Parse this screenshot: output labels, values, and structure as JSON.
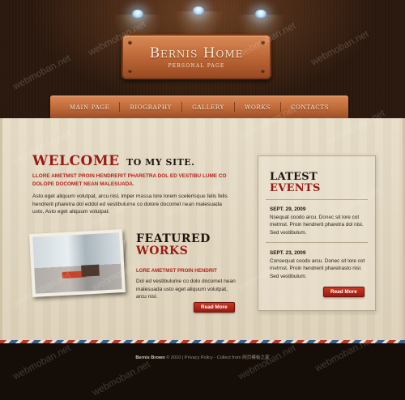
{
  "site": {
    "title": "Bernis Home",
    "subtitle": "PERSONAL PAGE"
  },
  "nav": {
    "items": [
      "MAIN PAGE",
      "BIOGRAPHY",
      "GALLERY",
      "WORKS",
      "CONTACTS"
    ]
  },
  "welcome": {
    "heading": "WELCOME",
    "heading_suffix": "TO MY SITE.",
    "lead": "LLORE AMETMST PROIN HENDRERIT PHARETRA DOL ED VESTIBU LUME CO DOLOPE DOCOMET NEAN MALESUADA.",
    "body": "Asto eget aliquum volutpat, arcu nisl, imper massa lore lorem scelerisque felis felis hendrerit pharetra dol eddol ed vestibulume co dolore docomet nean malesuada usto, Asto eget aliquum volutpat."
  },
  "featured": {
    "heading": "FEATURED",
    "heading_accent": "WORKS",
    "subtitle": "LORE AMETMST PROIN HENDRIT",
    "body": "Dol ed vestibulume co dolo docomet nean malesuada usto eget aliquum volutpat, arcu nisl.",
    "button": "Read More"
  },
  "events": {
    "heading": "LATEST",
    "heading_accent": "EVENTS",
    "items": [
      {
        "date": "SEPT. 29, 2009",
        "text": "Nsequat coodo arcu. Donec sit lore cot metmst. Proin hendrerit pharetra dol nisl. Sed vestibulum."
      },
      {
        "date": "SEPT. 23, 2009",
        "text": "Consequat coodo arcu. Donec sit lore cot metmst. Proin hendrerit pharetrasto nisl. Sed vestibulum."
      }
    ],
    "button": "Read More"
  },
  "footer": {
    "name": "Bernis Brown",
    "text": "© 2010 | Privacy Policy - Collect from 网页模板之家"
  },
  "watermark": "webmoban.net",
  "colors": {
    "accent_red": "#9b1b14",
    "wood": "#c36d3c",
    "paper": "#e2d7c1",
    "dark_bg": "#1a0f09"
  }
}
